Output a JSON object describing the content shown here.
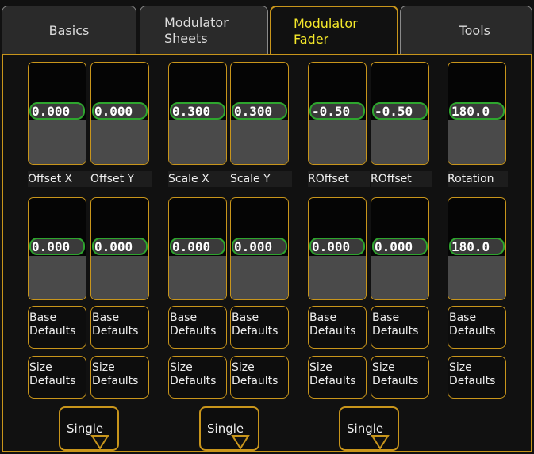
{
  "tabs": [
    {
      "label": "Basics",
      "active": false
    },
    {
      "label": "Modulator\nSheets",
      "active": false
    },
    {
      "label": "Modulator\nFader",
      "active": true
    },
    {
      "label": "Tools",
      "active": false
    }
  ],
  "top_faders": [
    {
      "value": "0.000",
      "label": "Offset X"
    },
    {
      "value": "0.000",
      "label": "Offset Y"
    },
    {
      "value": "0.300",
      "label": "Scale X"
    },
    {
      "value": "0.300",
      "label": "Scale Y"
    },
    {
      "value": "-0.50",
      "label": "ROffset"
    },
    {
      "value": "-0.50",
      "label": "ROffset"
    },
    {
      "value": "180.0",
      "label": "Rotation"
    }
  ],
  "bottom_faders": [
    {
      "value": "0.000"
    },
    {
      "value": "0.000"
    },
    {
      "value": "0.000"
    },
    {
      "value": "0.000"
    },
    {
      "value": "0.000"
    },
    {
      "value": "0.000"
    },
    {
      "value": "180.0"
    }
  ],
  "base_defaults_label": "Base\nDefaults",
  "size_defaults_label": "Size\nDefaults",
  "single_buttons": [
    {
      "label": "Single"
    },
    {
      "label": "Single"
    },
    {
      "label": "Single"
    }
  ],
  "colors": {
    "accent": "#c8951b",
    "active_tab_text": "#f5e82a",
    "value_border": "#2ea52e"
  },
  "icons": {
    "dropdown": "triangle-down-icon"
  }
}
